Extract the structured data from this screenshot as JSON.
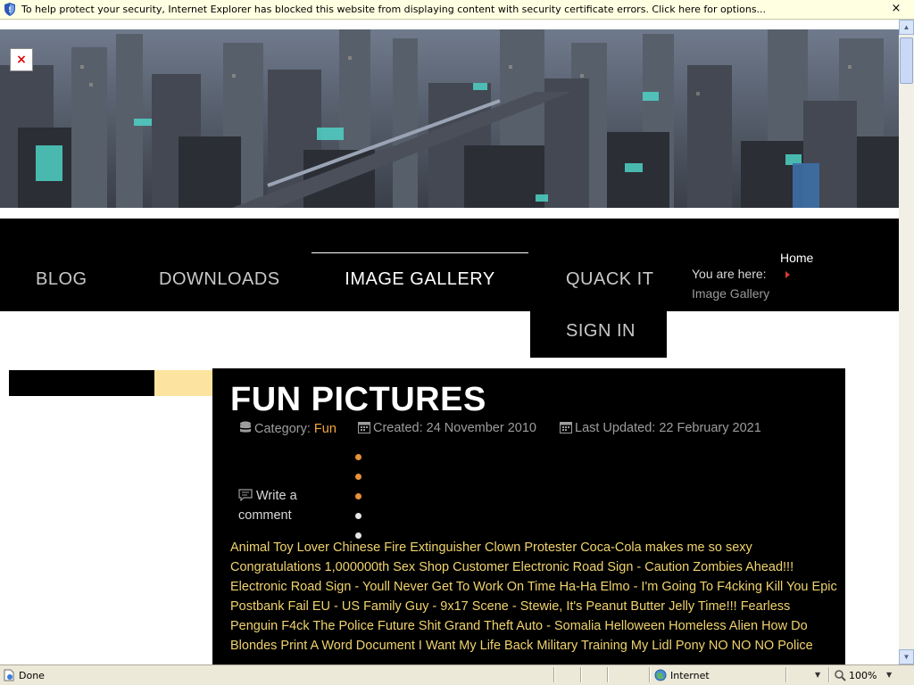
{
  "browser": {
    "infobar_message": "To help protect your security, Internet Explorer has blocked this website from displaying content with security certificate errors. Click here for options...",
    "infobar_close": "×",
    "status_text": "Done",
    "security_zone": "Internet",
    "zoom_level": "100%"
  },
  "nav": {
    "items": [
      {
        "label": "BLOG"
      },
      {
        "label": "DOWNLOADS"
      },
      {
        "label": "IMAGE GALLERY",
        "active": true
      },
      {
        "label": "QUACK IT"
      },
      {
        "label": "SIGN IN"
      }
    ]
  },
  "breadcrumb": {
    "prefix": "You are here:",
    "home": "Home",
    "current": "Image Gallery"
  },
  "article": {
    "title": "FUN PICTURES",
    "category_label": "Category:",
    "category_value": "Fun",
    "created": "Created: 24 November 2010",
    "updated": "Last Updated: 22 February 2021",
    "write_comment": "Write a comment",
    "body": "Animal Toy Lover Chinese Fire Extinguisher Clown Protester Coca-Cola makes me so sexy Congratulations 1,000000th Sex Shop Customer Electronic Road Sign - Caution Zombies Ahead!!! Electronic Road Sign - Youll Never Get To Work On Time Ha-Ha Elmo - I'm Going To F4cking Kill You Epic Postbank Fail EU - US Family Guy - 9x17 Scene - Stewie, It's Peanut Butter Jelly Time!!! Fearless Penguin F4ck The Police Future Shit Grand Theft Auto - Somalia Helloween Homeless Alien How Do Blondes Print A Word Document I Want My Life Back Military Training My Lidl Pony NO NO NO Police"
  },
  "colors": {
    "accent_orange": "#f4a742",
    "body_text_yellow": "#f0d36d",
    "side_yellow": "#fce3a0",
    "breadcrumb_arrow": "#d43c2c",
    "nav_background": "#000000"
  },
  "icons": [
    "shield-icon",
    "close-icon",
    "broken-image-icon",
    "database-icon",
    "calendar-icon",
    "comment-icon",
    "page-icon",
    "globe-icon",
    "zoom-icon"
  ]
}
